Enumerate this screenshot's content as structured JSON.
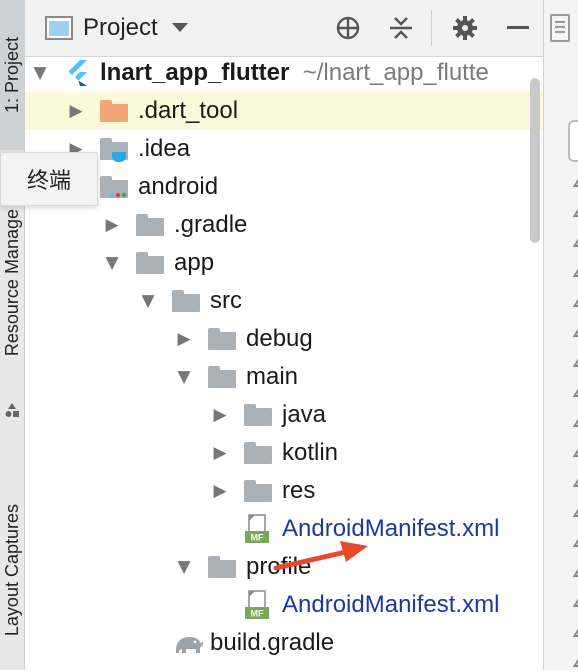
{
  "left_strip": {
    "tabs": [
      {
        "label": "1: Project"
      },
      {
        "label": "Resource Manage"
      },
      {
        "label": "Layout Captures"
      }
    ]
  },
  "tooltip": {
    "text": "终端"
  },
  "header": {
    "title": "Project",
    "icons": [
      "target-icon",
      "collapse-icon",
      "gear-icon",
      "minimize-icon"
    ]
  },
  "tree": {
    "rows": [
      {
        "label": "lnart_app_flutter",
        "path": "~/lnart_app_flutte"
      },
      {
        "label": ".dart_tool"
      },
      {
        "label": ".idea"
      },
      {
        "label": "android"
      },
      {
        "label": ".gradle"
      },
      {
        "label": "app"
      },
      {
        "label": "src"
      },
      {
        "label": "debug"
      },
      {
        "label": "main"
      },
      {
        "label": "java"
      },
      {
        "label": "kotlin"
      },
      {
        "label": "res"
      },
      {
        "label": "AndroidManifest.xml",
        "badge": "MF"
      },
      {
        "label": "profile"
      },
      {
        "label": "AndroidManifest.xml",
        "badge": "MF"
      },
      {
        "label": "build.gradle"
      }
    ]
  },
  "colors": {
    "folder_gray": "#aab2b8",
    "folder_orange": "#f0a874",
    "selected_row": "#fbf8dc",
    "xml_blue": "#1d38a0",
    "badge_green": "#7aa75a",
    "arrow_red": "#e64a2e"
  }
}
